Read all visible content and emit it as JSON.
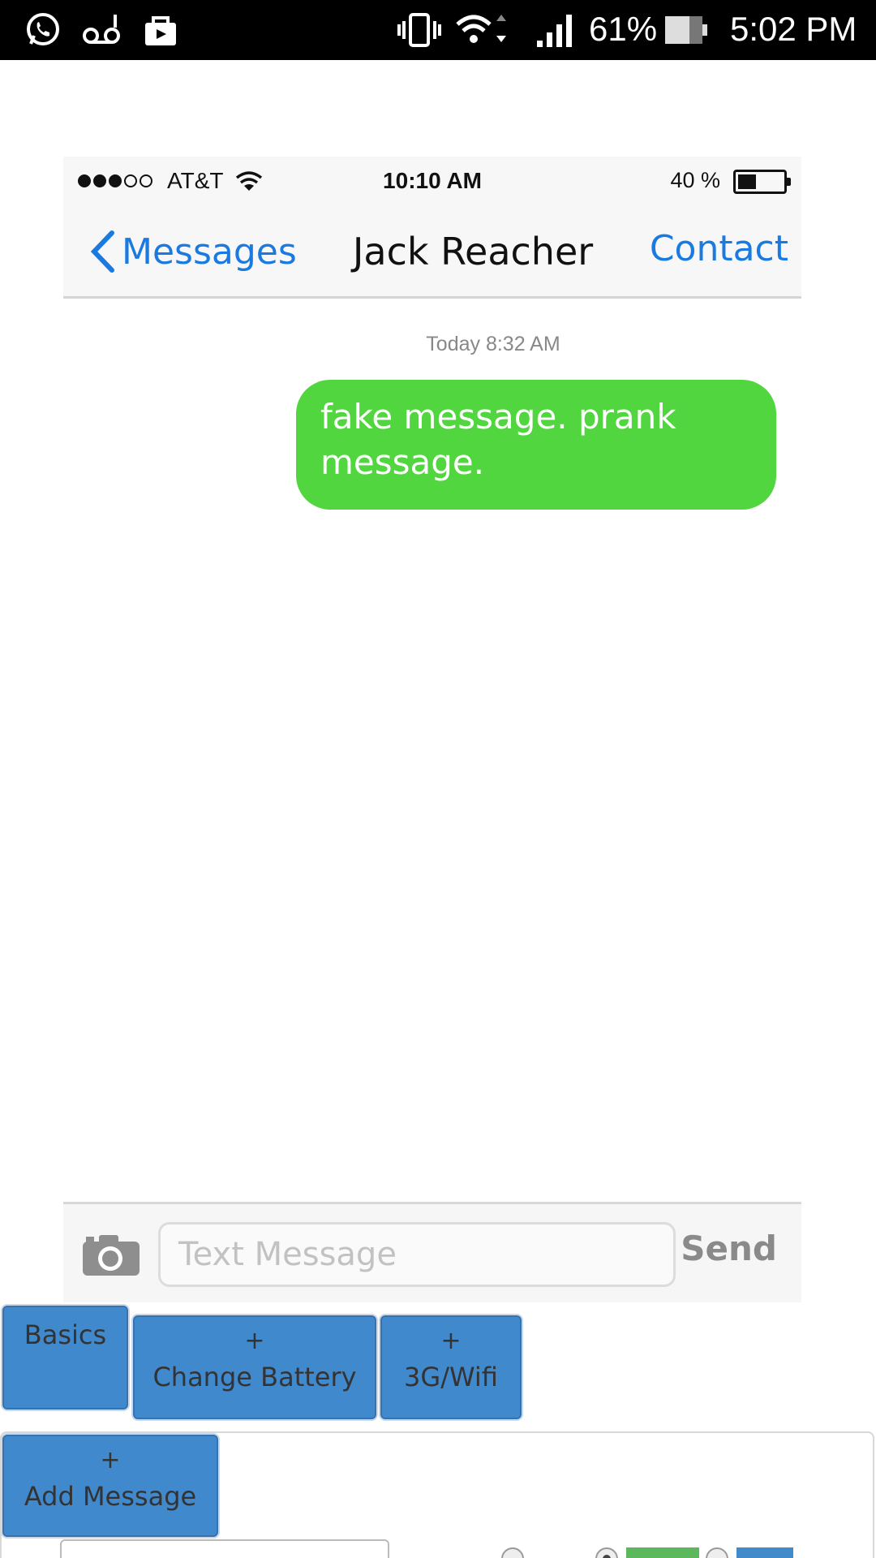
{
  "android_status": {
    "battery_pct": "61%",
    "time": "5:02 PM",
    "icons": [
      "whatsapp-icon",
      "voicemail-icon",
      "store-bag-icon",
      "vibrate-icon",
      "wifi-icon",
      "data-arrows-icon",
      "signal-icon",
      "battery-icon"
    ]
  },
  "ios_status": {
    "carrier": "AT&T",
    "time": "10:10 AM",
    "battery_pct": "40 %",
    "signal_bars_filled": 3,
    "signal_bars_total": 5,
    "battery_level": 0.4
  },
  "nav": {
    "back_label": "Messages",
    "title": "Jack Reacher",
    "contact_label": "Contact",
    "accent_color": "#1a7ae0"
  },
  "conversation": {
    "timestamp": "Today 8:32 AM",
    "messages": [
      {
        "text": "fake message. prank message.",
        "color": "#52d63f",
        "side": "right"
      }
    ]
  },
  "compose": {
    "placeholder": "Text Message",
    "send_label": "Send"
  },
  "editor": {
    "tabs": [
      {
        "icon": "",
        "label": "Basics"
      },
      {
        "icon": "+",
        "label": "Change Battery"
      },
      {
        "icon": "+",
        "label": "3G/Wifi"
      }
    ],
    "add_message": {
      "icon": "+",
      "label": "Add Message"
    },
    "color_options": [
      {
        "color": "#cccccc",
        "selected": false
      },
      {
        "color": "#5cb85c",
        "selected": true
      },
      {
        "color": "#428bca",
        "selected": false
      }
    ]
  }
}
